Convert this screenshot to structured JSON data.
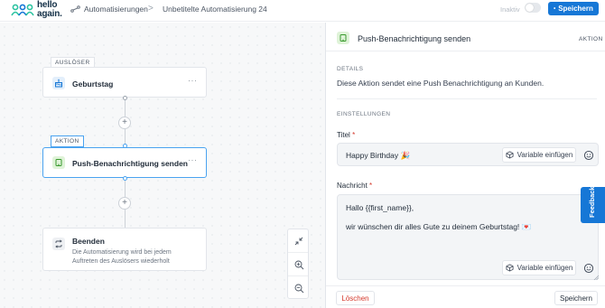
{
  "topbar": {
    "logo_text_line1": "hello",
    "logo_text_line2": "again.",
    "breadcrumb_parent": "Automatisierungen",
    "breadcrumb_separator": ">",
    "breadcrumb_current": "Unbetitelte Automatisierung 24",
    "status_label": "Inaktiv",
    "toggle_on": false,
    "save_label": "Speichern",
    "accent_color": "#1677d6"
  },
  "canvas": {
    "trigger_tag": "AUSLÖSER",
    "trigger_title": "Geburtstag",
    "trigger_icon": "cake-icon",
    "action_tag": "AKTION",
    "action_title": "Push-Benachrichtigung senden",
    "action_icon": "push-notification-icon",
    "end_title": "Beenden",
    "end_description_line1": "Die Automatisierung wird bei jedem",
    "end_description_line2": "Auftreten des Auslösers wiederholt",
    "end_icon": "repeat-icon",
    "node_menu": "···",
    "add_symbol": "+",
    "zoom_controls": [
      "fit-view-icon",
      "zoom-in-icon",
      "zoom-out-icon"
    ]
  },
  "panel": {
    "title": "Push-Benachrichtigung senden",
    "kind": "AKTION",
    "details_label": "DETAILS",
    "details_text": "Diese Aktion sendet eine Push Benachrichtigung an Kunden.",
    "settings_label": "EINSTELLUNGEN",
    "title_field_label": "Titel",
    "title_field_value": "Happy Birthday 🎉",
    "message_field_label": "Nachricht",
    "message_line1": "Hallo {{first_name}},",
    "message_line2": "wir wünschen dir alles Gute zu deinem Geburtstag! 💌",
    "required_marker": "*",
    "variable_button": "Variable einfügen",
    "delete_button": "Löschen",
    "save_button": "Speichern"
  },
  "feedback_tab": "Feedback"
}
